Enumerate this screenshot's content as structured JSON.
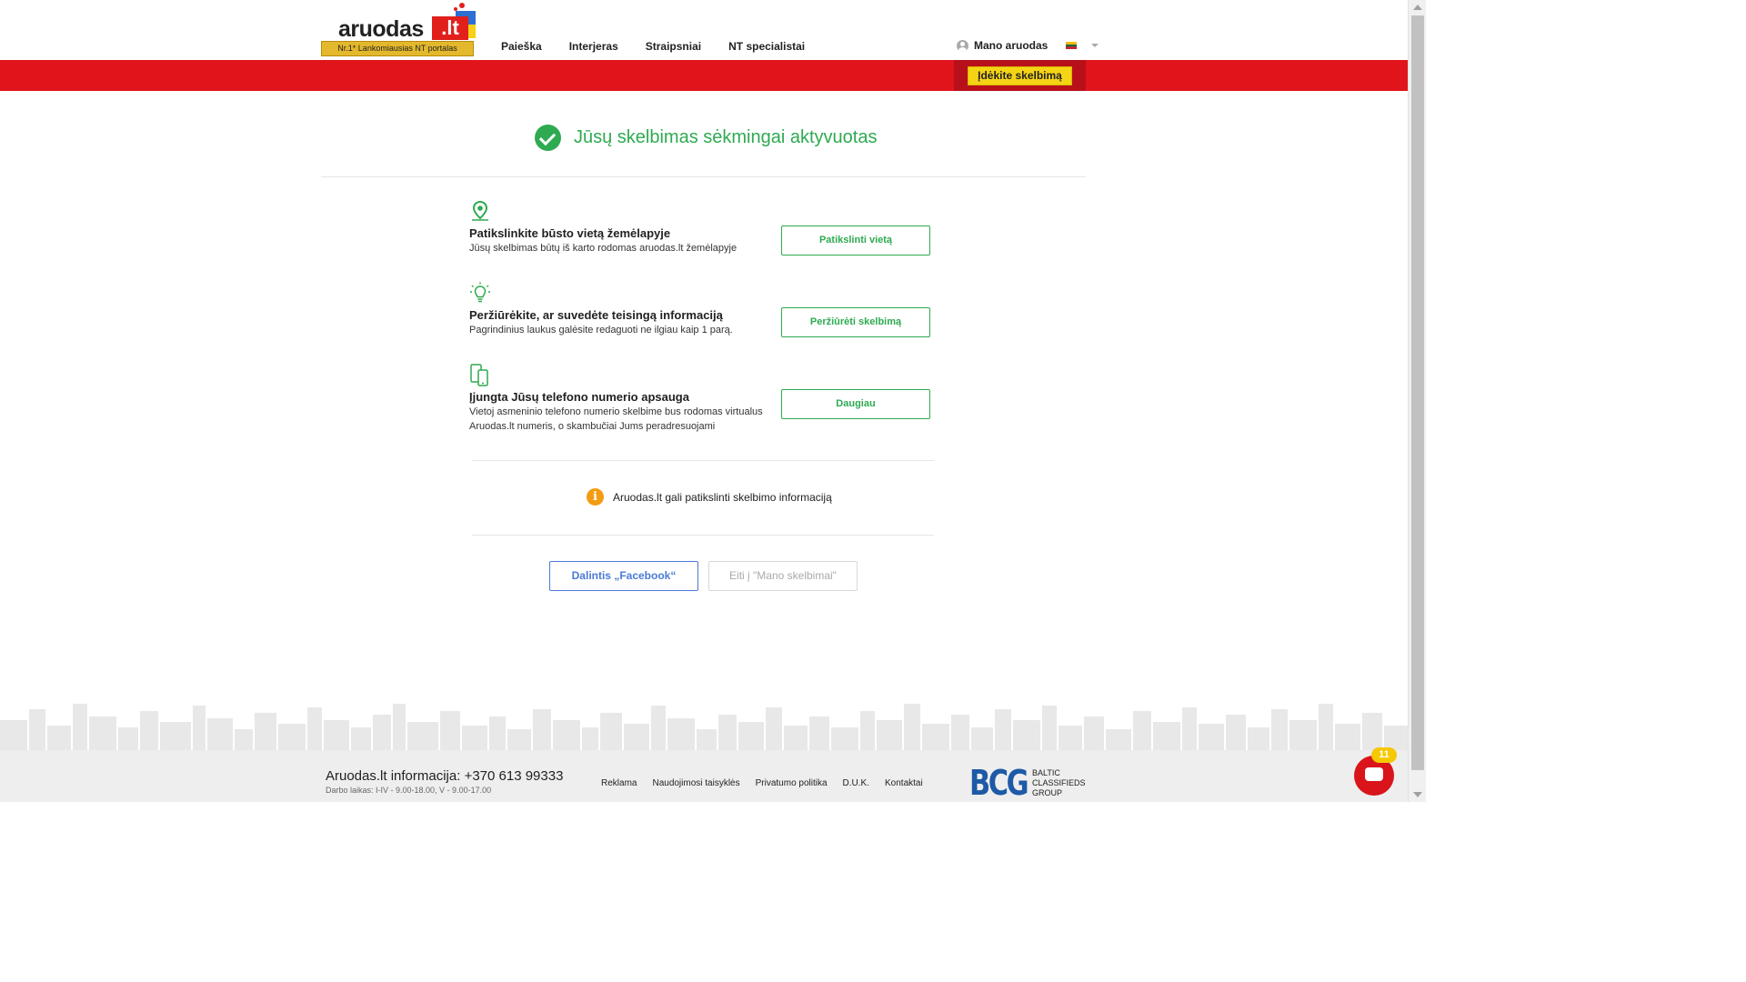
{
  "header": {
    "logo_text": "aruodas",
    "logo_tld": ".lt",
    "logo_tagline": "Nr.1* Lankomiausias NT portalas",
    "nav": [
      "Paieška",
      "Interjeras",
      "Straipsniai",
      "NT specialistai"
    ],
    "account_label": "Mano aruodas",
    "post_button": "Įdėkite skelbimą"
  },
  "success": {
    "title": "Jūsų skelbimas sėkmingai aktyvuotas"
  },
  "steps": [
    {
      "icon": "map-pin-icon",
      "title": "Patikslinkite būsto vietą žemėlapyje",
      "desc": "Jūsų skelbimas būtų iš karto rodomas aruodas.lt žemėlapyje",
      "button": "Patikslinti vietą"
    },
    {
      "icon": "lightbulb-icon",
      "title": "Peržiūrėkite, ar suvedėte teisingą informaciją",
      "desc": "Pagrindinius laukus galėsite redaguoti ne ilgiau kaip 1 parą.",
      "button": "Peržiūrėti skelbimą"
    },
    {
      "icon": "phone-protection-icon",
      "title": "Įjungta Jūsų telefono numerio apsauga",
      "desc": "Vietoj asmeninio telefono numerio skelbime bus rodomas virtualus Aruodas.lt numeris, o skambučiai Jums peradresuojami",
      "button": "Daugiau"
    }
  ],
  "info": {
    "text": "Aruodas.lt gali patikslinti skelbimo informaciją"
  },
  "actions": {
    "facebook": "Dalintis „Facebook“",
    "my_ads": "Eiti į \"Mano skelbimai\""
  },
  "footer": {
    "phone": "Aruodas.lt informacija: +370 613 99333",
    "hours": "Darbo laikas: I-IV - 9.00-18.00, V - 9.00-17.00",
    "links": [
      "Reklama",
      "Naudojimosi taisyklės",
      "Privatumo politika",
      "D.U.K.",
      "Kontaktai"
    ],
    "bcg_mark": "BCG",
    "bcg_lines": [
      "BALTIC",
      "CLASSIFIEDS",
      "GROUP"
    ]
  },
  "chat": {
    "badge": "11"
  },
  "colors": {
    "brand_red": "#e1141b",
    "accent_green": "#2eaa51",
    "post_yellow": "#f5d315",
    "facebook_blue": "#4a7bd5",
    "info_orange": "#f39c12"
  }
}
